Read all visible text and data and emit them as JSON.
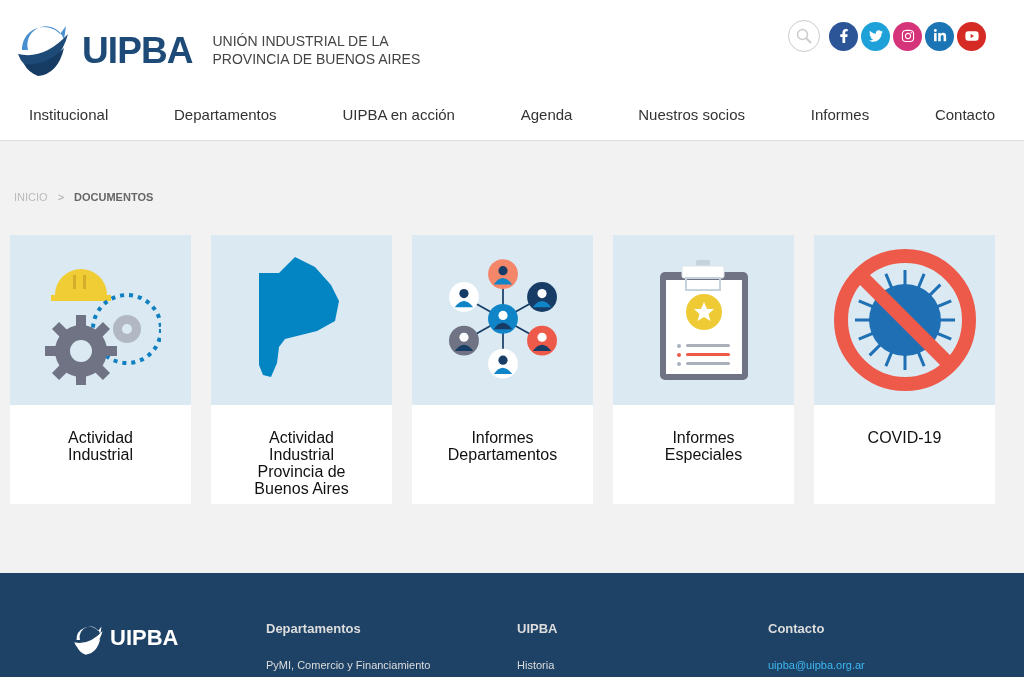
{
  "header": {
    "logo": "UIPBA",
    "subtitle": [
      "UNIÓN INDUSTRIAL DE LA",
      "PROVINCIA DE BUENOS AIRES"
    ],
    "social": [
      {
        "kind": "facebook"
      },
      {
        "kind": "twitter"
      },
      {
        "kind": "instagram"
      },
      {
        "kind": "linkedin"
      },
      {
        "kind": "youtube"
      }
    ]
  },
  "nav": [
    "Institucional",
    "Departamentos",
    "UIPBA en acción",
    "Agenda",
    "Nuestros socios",
    "Informes",
    "Contacto"
  ],
  "breadcrumb": {
    "items": [
      "INICIO",
      "DOCUMENTOS"
    ],
    "separator": ">"
  },
  "cards": [
    {
      "kind": "industry",
      "title": "Actividad Industrial"
    },
    {
      "kind": "map",
      "title": "Actividad Industrial Provincia de Buenos Aires"
    },
    {
      "kind": "network",
      "title": "Informes Departamentos"
    },
    {
      "kind": "clipboard",
      "title": "Informes Especiales"
    },
    {
      "kind": "virus",
      "title": "COVID-19"
    }
  ],
  "footer": {
    "logo": "UIPBA",
    "columns": [
      {
        "heading": "Departamentos",
        "links": [
          "PyMI, Comercio y Financiamiento"
        ],
        "accent": false
      },
      {
        "heading": "UIPBA",
        "links": [
          "Historia"
        ],
        "accent": false
      },
      {
        "heading": "Contacto",
        "links": [
          "uipba@uipba.org.ar"
        ],
        "accent": true
      }
    ]
  }
}
